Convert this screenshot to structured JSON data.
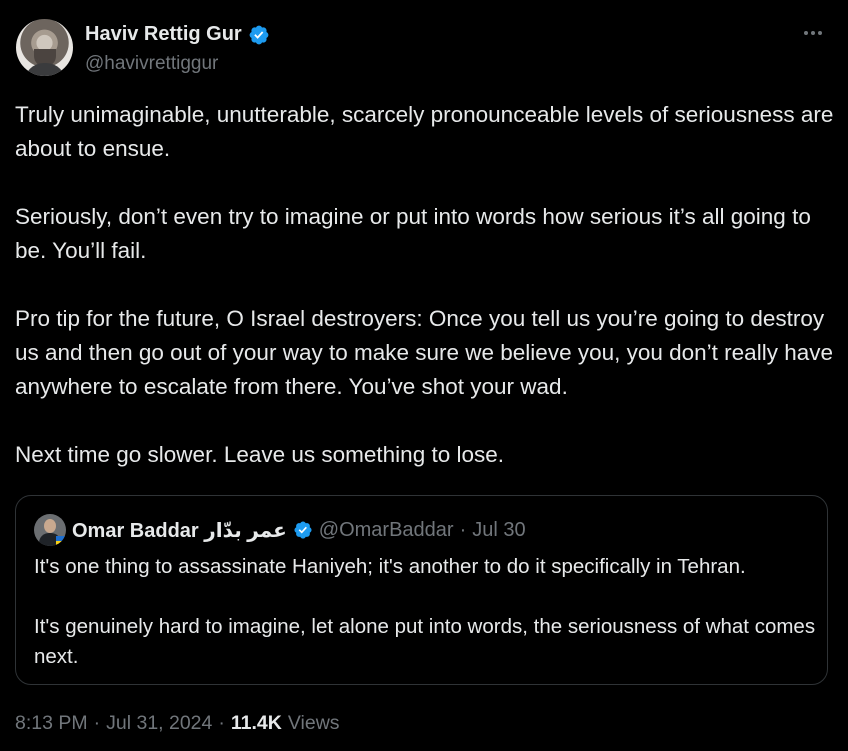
{
  "author": {
    "name": "Haviv Rettig Gur",
    "handle": "@havivrettiggur"
  },
  "tweet": {
    "paragraphs": [
      "Truly unimaginable, unutterable, scarcely pronounceable levels of seriousness are about to ensue.",
      "Seriously, don’t even try to imagine or put into words how serious it’s all going to be. You’ll fail.",
      "Pro tip for the future, O Israel destroyers: Once you tell us you’re going to destroy us and then go out of your way to make sure we believe you, you don’t really have anywhere to escalate from there. You’ve shot your wad.",
      "Next time go slower. Leave us something to lose."
    ]
  },
  "quote": {
    "name": "Omar Baddar عمر بدّار",
    "handle": "@OmarBaddar",
    "separator": "·",
    "date": "Jul 30",
    "paragraphs": [
      "It's one thing to assassinate Haniyeh; it's another to do it specifically in Tehran.",
      "It's genuinely hard to imagine, let alone put into words, the seriousness of what comes next."
    ]
  },
  "meta": {
    "time": "8:13 PM",
    "sep1": "·",
    "date": "Jul 31, 2024",
    "sep2": "·",
    "views_count": "11.4K",
    "views_label": "Views"
  },
  "colors": {
    "background": "#000000",
    "text": "#e7e9ea",
    "secondary": "#71767b",
    "verified": "#1d9bf0",
    "border": "#2f3336"
  },
  "icons": {
    "verified": "verified-badge-icon",
    "more": "more-dots-icon"
  }
}
